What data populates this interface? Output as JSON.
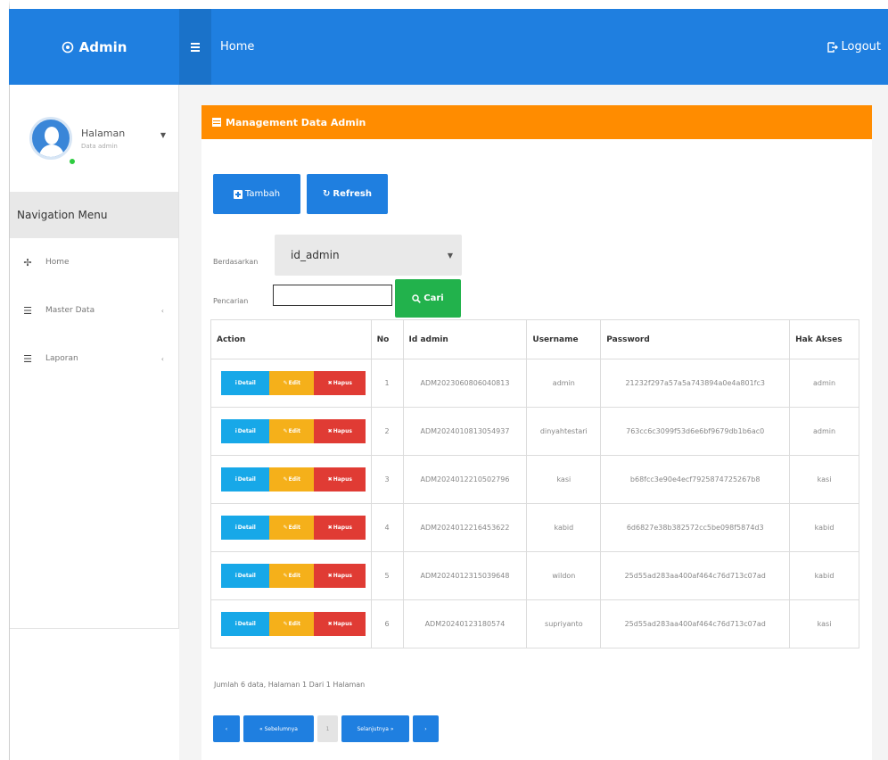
{
  "header": {
    "brand": "Admin",
    "title": "Home",
    "logout": "Logout"
  },
  "sidebar": {
    "profile_name": "Halaman",
    "profile_role": "Data admin",
    "nav_header": "Navigation Menu",
    "items": [
      {
        "label": "Home"
      },
      {
        "label": "Master Data"
      },
      {
        "label": "Laporan"
      }
    ]
  },
  "card": {
    "title": "Management Data Admin",
    "add_label": "Tambah",
    "refresh_label": "Refresh"
  },
  "filter": {
    "by_label": "Berdasarkan",
    "by_value": "id_admin",
    "search_label": "Pencarian",
    "search_value": "",
    "search_button": "Cari"
  },
  "table": {
    "headers": [
      "Action",
      "No",
      "Id admin",
      "Username",
      "Password",
      "Hak Akses"
    ],
    "action_labels": {
      "detail": "Detail",
      "edit": "Edit",
      "hapus": "Hapus"
    },
    "rows": [
      {
        "no": "1",
        "id": "ADM2023060806040813",
        "username": "admin",
        "password": "21232f297a57a5a743894a0e4a801fc3",
        "akses": "admin"
      },
      {
        "no": "2",
        "id": "ADM2024010813054937",
        "username": "dinyahtestari",
        "password": "763cc6c3099f53d6e6bf9679db1b6ac0",
        "akses": "admin"
      },
      {
        "no": "3",
        "id": "ADM2024012210502796",
        "username": "kasi",
        "password": "b68fcc3e90e4ecf7925874725267b8",
        "akses": "kasi"
      },
      {
        "no": "4",
        "id": "ADM2024012216453622",
        "username": "kabid",
        "password": "6d6827e38b382572cc5be098f5874d3",
        "akses": "kabid"
      },
      {
        "no": "5",
        "id": "ADM2024012315039648",
        "username": "wildon",
        "password": "25d55ad283aa400af464c76d713c07ad",
        "akses": "kabid"
      },
      {
        "no": "6",
        "id": "ADM20240123180574",
        "username": "supriyanto",
        "password": "25d55ad283aa400af464c76d713c07ad",
        "akses": "kasi"
      }
    ]
  },
  "pagination": {
    "summary": "Jumlah 6 data, Halaman 1 Dari 1 Halaman",
    "first": "‹",
    "prev": "« Sebelumnya",
    "current": "1",
    "next": "Selanjutnya »",
    "last": "›"
  },
  "colors": {
    "primary": "#1f7fe0",
    "header_orange": "#ff8c00",
    "success": "#22b24c",
    "info": "#17a8e8",
    "warning": "#f5b01a",
    "danger": "#e03b34"
  }
}
